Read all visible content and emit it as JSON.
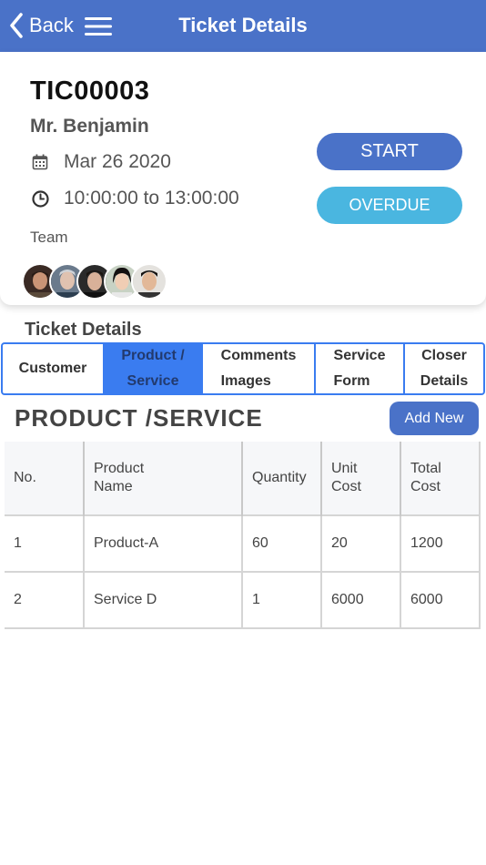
{
  "header": {
    "back_label": "Back",
    "title": "Ticket Details",
    "bg_color": "#4a72c8"
  },
  "ticket": {
    "id": "TIC00003",
    "customer": "Mr. Benjamin",
    "date": "Mar 26 2020",
    "time": "10:00:00 to 13:00:00",
    "team_label": "Team",
    "avatars": [
      "avatar-1",
      "avatar-2",
      "avatar-3",
      "avatar-4",
      "avatar-5"
    ]
  },
  "actions": {
    "start_label": "START",
    "overdue_label": "OVERDUE",
    "start_color": "#4a72c8",
    "overdue_color": "#4ab6e0"
  },
  "section_label": "Ticket Details",
  "tabs": [
    {
      "line1": "Customer",
      "line2": "",
      "active": false
    },
    {
      "line1": "Product /",
      "line2": "Service",
      "active": true
    },
    {
      "line1": "Comments",
      "line2": "Images",
      "active": false
    },
    {
      "line1": "Service",
      "line2": "Form",
      "active": false
    },
    {
      "line1": "Closer",
      "line2": "Details",
      "active": false
    }
  ],
  "product": {
    "heading": "PRODUCT /SERVICE",
    "add_new_label": "Add New",
    "columns": [
      {
        "line1": "No.",
        "line2": ""
      },
      {
        "line1": "Product",
        "line2": "Name"
      },
      {
        "line1": "Quantity",
        "line2": ""
      },
      {
        "line1": "Unit",
        "line2": "Cost"
      },
      {
        "line1": "Total",
        "line2": "Cost"
      }
    ],
    "rows": [
      [
        "1",
        "Product-A",
        "60",
        "20",
        "1200"
      ],
      [
        "2",
        "Service D",
        "1",
        "6000",
        "6000"
      ]
    ]
  }
}
